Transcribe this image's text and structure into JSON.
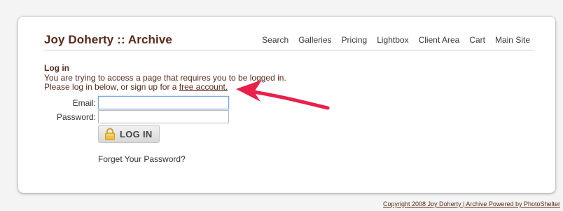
{
  "site": {
    "title": "Joy Doherty :: Archive"
  },
  "nav": {
    "items": [
      "Search",
      "Galleries",
      "Pricing",
      "Lightbox",
      "Client Area",
      "Cart",
      "Main Site"
    ]
  },
  "login": {
    "heading": "Log in",
    "message_line1": "You are trying to access a page that requires you to be logged in.",
    "message_line2_prefix": "Please log in below, or sign up for a ",
    "free_account_link": "free account.",
    "email_label": "Email:",
    "email_value": "",
    "password_label": "Password:",
    "password_value": "",
    "button_label": "LOG IN",
    "button_icon": "lock-icon",
    "forgot_link": "Forget Your Password?"
  },
  "footer": {
    "text": "Copyright 2008 Joy Doherty | Archive Powered by PhotoShelter"
  },
  "colors": {
    "title": "#5a2a1a",
    "arrow": "#e8204a",
    "background": "#f4f4f4"
  }
}
